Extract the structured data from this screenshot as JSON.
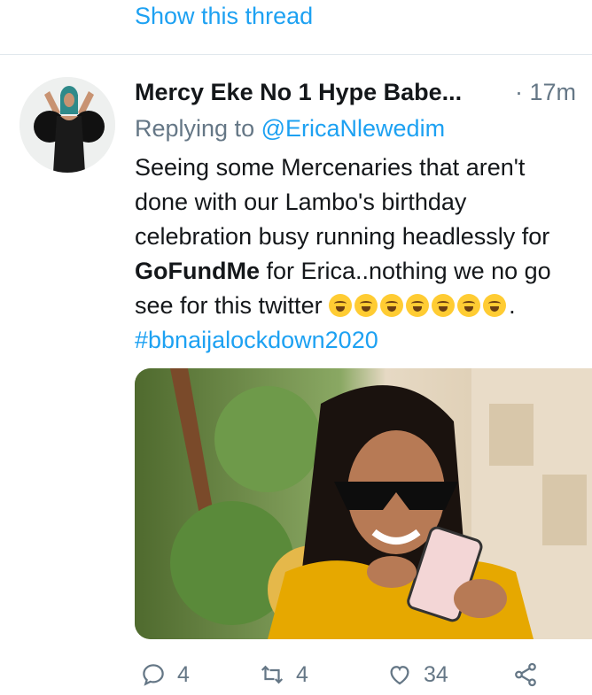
{
  "thread": {
    "show_thread_label": "Show this thread"
  },
  "tweet": {
    "author_name": "Mercy Eke No 1 Hype Babe...",
    "timestamp": "· 17m",
    "reply_prefix": "Replying to",
    "reply_handle": "@EricaNlewedim",
    "text_lines": [
      "Seeing some Mercenaries that aren't",
      "done with our Lambo's birthday",
      "celebration busy running headlessly for",
      "GoFundMe",
      " for Erica..nothing we no go",
      "see for this twitter"
    ],
    "emoji_name": "rolling-on-the-floor-laughing-emoji",
    "emoji_count": 7,
    "text_end": ".",
    "hashtag": "#bbnaijalockdown2020",
    "media": {
      "description": "photo-of-woman-in-sunglasses-with-phone"
    }
  },
  "actions": {
    "reply_count": "4",
    "retweet_count": "4",
    "like_count": "34"
  },
  "colors": {
    "link": "#1da1f2",
    "muted": "#657786",
    "text": "#14171a",
    "divider": "#e1e8ed"
  }
}
